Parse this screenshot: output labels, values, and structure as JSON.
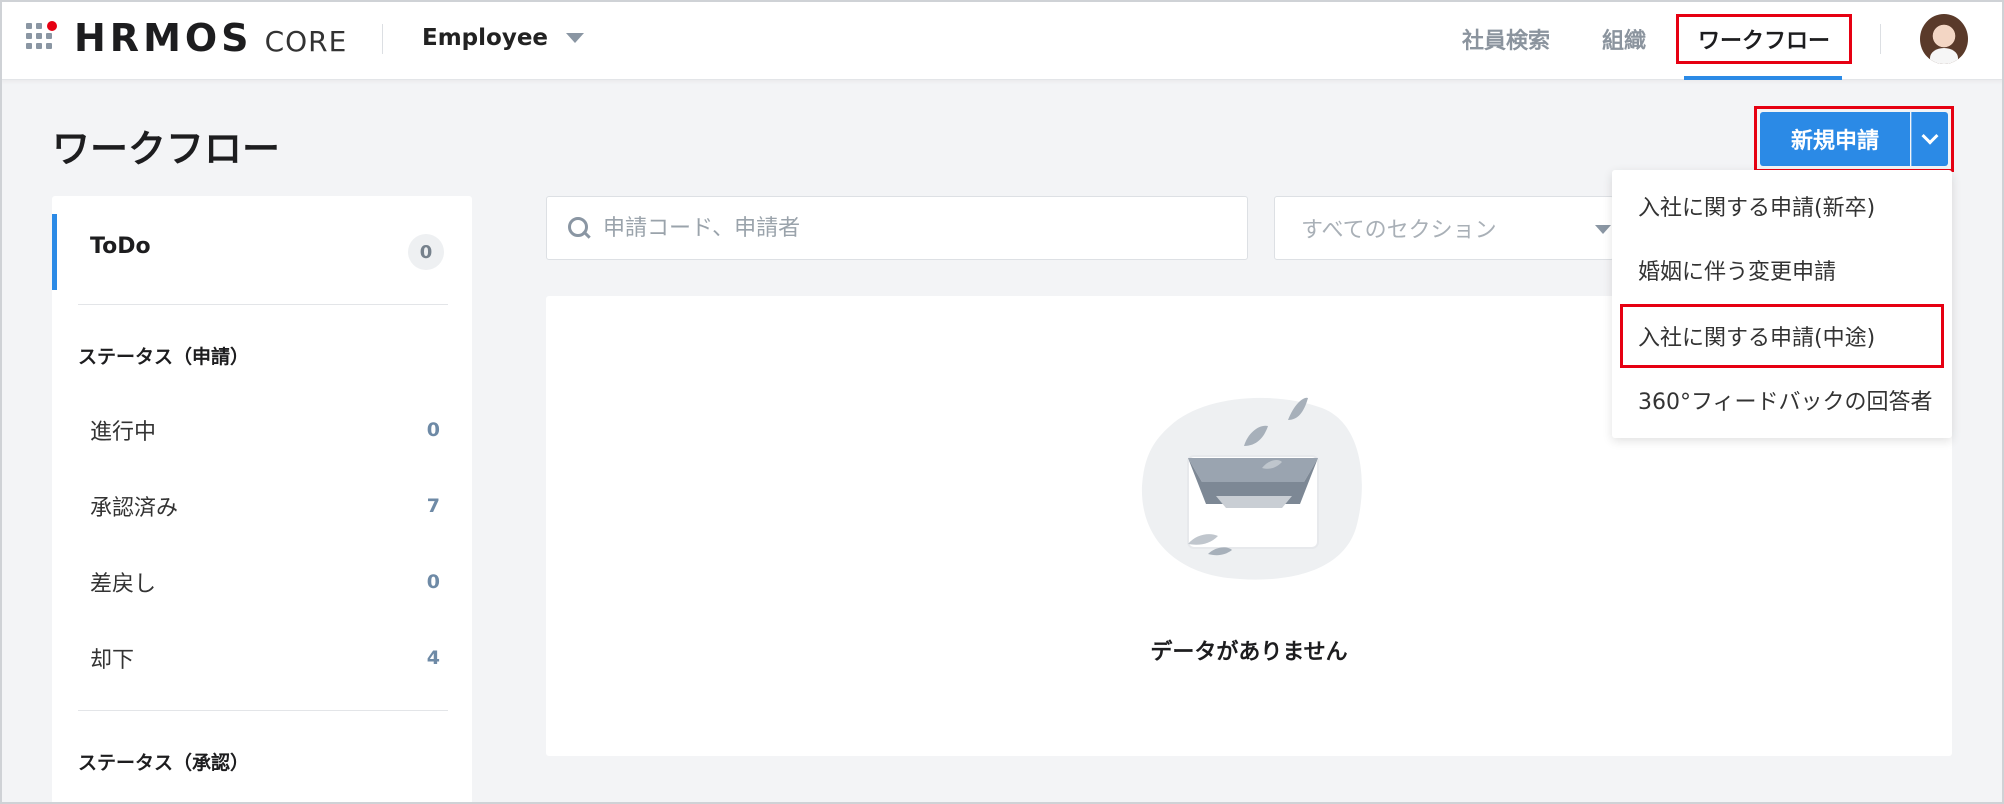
{
  "header": {
    "brand": "HRMOS",
    "brand_sub": "CORE",
    "role": "Employee",
    "nav": [
      "社員検索",
      "組織",
      "ワークフロー"
    ]
  },
  "page": {
    "title": "ワークフロー",
    "new_button": "新規申請"
  },
  "dropdown": {
    "items": [
      "入社に関する申請(新卒)",
      "婚姻に伴う変更申請",
      "入社に関する申請(中途)",
      "360°フィードバックの回答者"
    ]
  },
  "sidebar": {
    "todo": {
      "label": "ToDo",
      "count": "0"
    },
    "section_request": "ステータス（申請）",
    "items": [
      {
        "label": "進行中",
        "count": "0"
      },
      {
        "label": "承認済み",
        "count": "7"
      },
      {
        "label": "差戻し",
        "count": "0"
      },
      {
        "label": "却下",
        "count": "4"
      }
    ],
    "section_approval": "ステータス（承認）"
  },
  "filters": {
    "search_placeholder": "申請コード、申請者",
    "section_placeholder": "すべてのセクション"
  },
  "empty": {
    "message": "データがありません"
  },
  "colors": {
    "accent": "#2b8ae6",
    "highlight": "#e60012",
    "brand_dot": "#e60012"
  }
}
